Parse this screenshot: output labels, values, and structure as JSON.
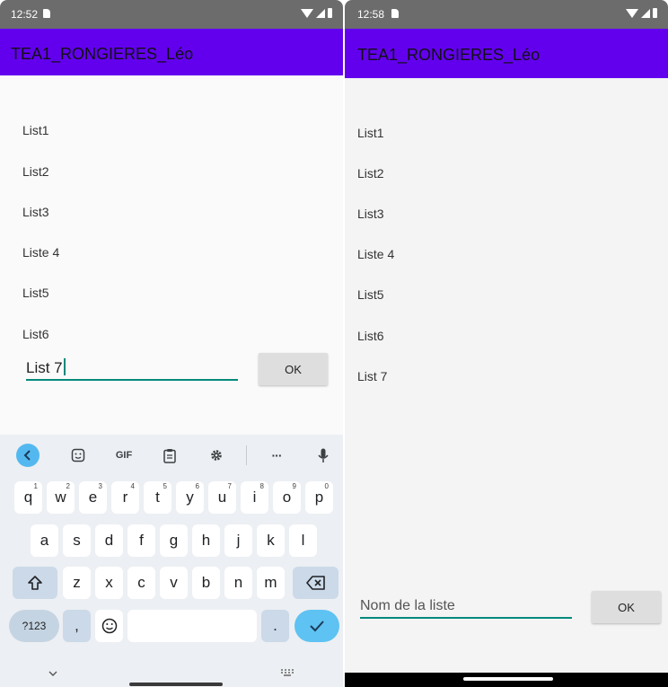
{
  "left": {
    "status": {
      "time": "12:52"
    },
    "app_title": "TEA1_RONGIERES_Léo",
    "list_items": [
      "List1",
      "List2",
      "List3",
      "Liste 4",
      "List5",
      "List6"
    ],
    "input": {
      "value": "List 7"
    },
    "ok_label": "OK",
    "keyboard": {
      "toolbar": {
        "gif_label": "GIF",
        "more_label": "···"
      },
      "row1": [
        {
          "k": "q",
          "n": "1"
        },
        {
          "k": "w",
          "n": "2"
        },
        {
          "k": "e",
          "n": "3"
        },
        {
          "k": "r",
          "n": "4"
        },
        {
          "k": "t",
          "n": "5"
        },
        {
          "k": "y",
          "n": "6"
        },
        {
          "k": "u",
          "n": "7"
        },
        {
          "k": "i",
          "n": "8"
        },
        {
          "k": "o",
          "n": "9"
        },
        {
          "k": "p",
          "n": "0"
        }
      ],
      "row2": [
        "a",
        "s",
        "d",
        "f",
        "g",
        "h",
        "j",
        "k",
        "l"
      ],
      "row3": [
        "z",
        "x",
        "c",
        "v",
        "b",
        "n",
        "m"
      ],
      "sym_label": "?123",
      "comma": ",",
      "period": "."
    }
  },
  "right": {
    "status": {
      "time": "12:58"
    },
    "app_title": "TEA1_RONGIERES_Léo",
    "list_items": [
      "List1",
      "List2",
      "List3",
      "Liste 4",
      "List5",
      "List6",
      "List 7"
    ],
    "input": {
      "placeholder": "Nom de la liste"
    },
    "ok_label": "OK"
  },
  "colors": {
    "app_bar": "#6200ee",
    "accent": "#00897b",
    "status_bar": "#6c6c6c"
  },
  "icons": [
    "sim-card-icon",
    "wifi-icon",
    "signal-icon",
    "battery-icon",
    "back-chevron-icon",
    "sticker-icon",
    "clipboard-icon",
    "settings-gear-icon",
    "microphone-icon",
    "shift-icon",
    "backspace-icon",
    "emoji-icon",
    "enter-check-icon",
    "hide-keyboard-icon",
    "keyboard-switch-icon"
  ]
}
